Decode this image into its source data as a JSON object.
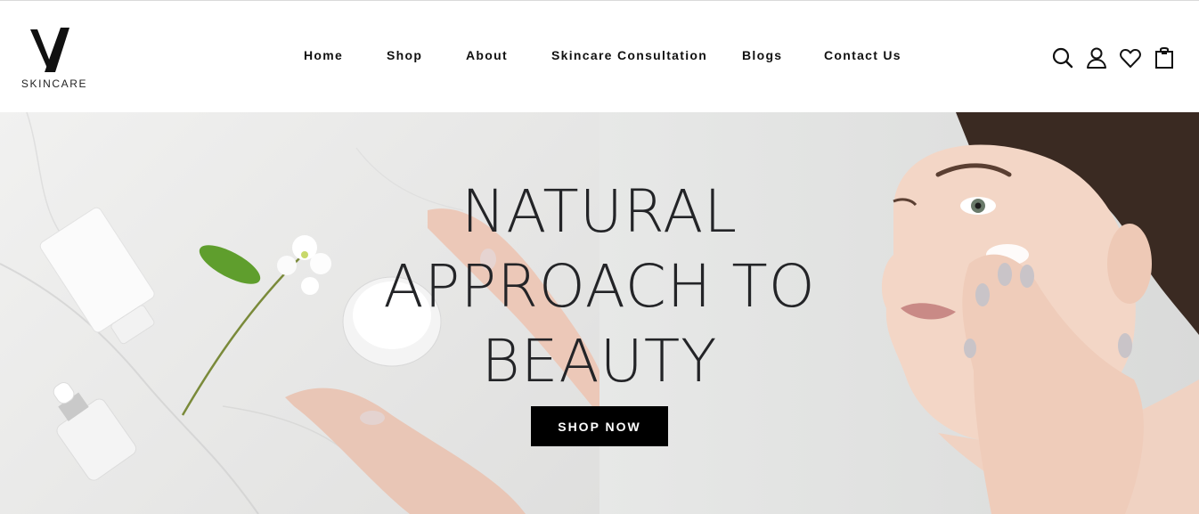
{
  "brand": {
    "logo_text": "SKINCARE",
    "logo_letter": "V"
  },
  "nav": {
    "items": [
      {
        "label": "Home"
      },
      {
        "label": "Shop"
      },
      {
        "label": "About"
      },
      {
        "label": "Skincare Consultation"
      },
      {
        "label": "Blogs"
      },
      {
        "label": "Contact Us"
      }
    ]
  },
  "header_icons": [
    "search-icon",
    "account-icon",
    "wishlist-icon",
    "cart-icon"
  ],
  "hero": {
    "headline_lines": [
      "NATURAL",
      "APPROACH TO",
      "BEAUTY"
    ],
    "cta_label": "SHOP NOW",
    "images": {
      "left": "skincare-products-on-marble",
      "right": "woman-applying-cream"
    }
  },
  "colors": {
    "header_bg": "#ffffff",
    "text": "#111111",
    "headline": "#232427",
    "button_bg": "#000000",
    "button_text": "#ffffff"
  }
}
